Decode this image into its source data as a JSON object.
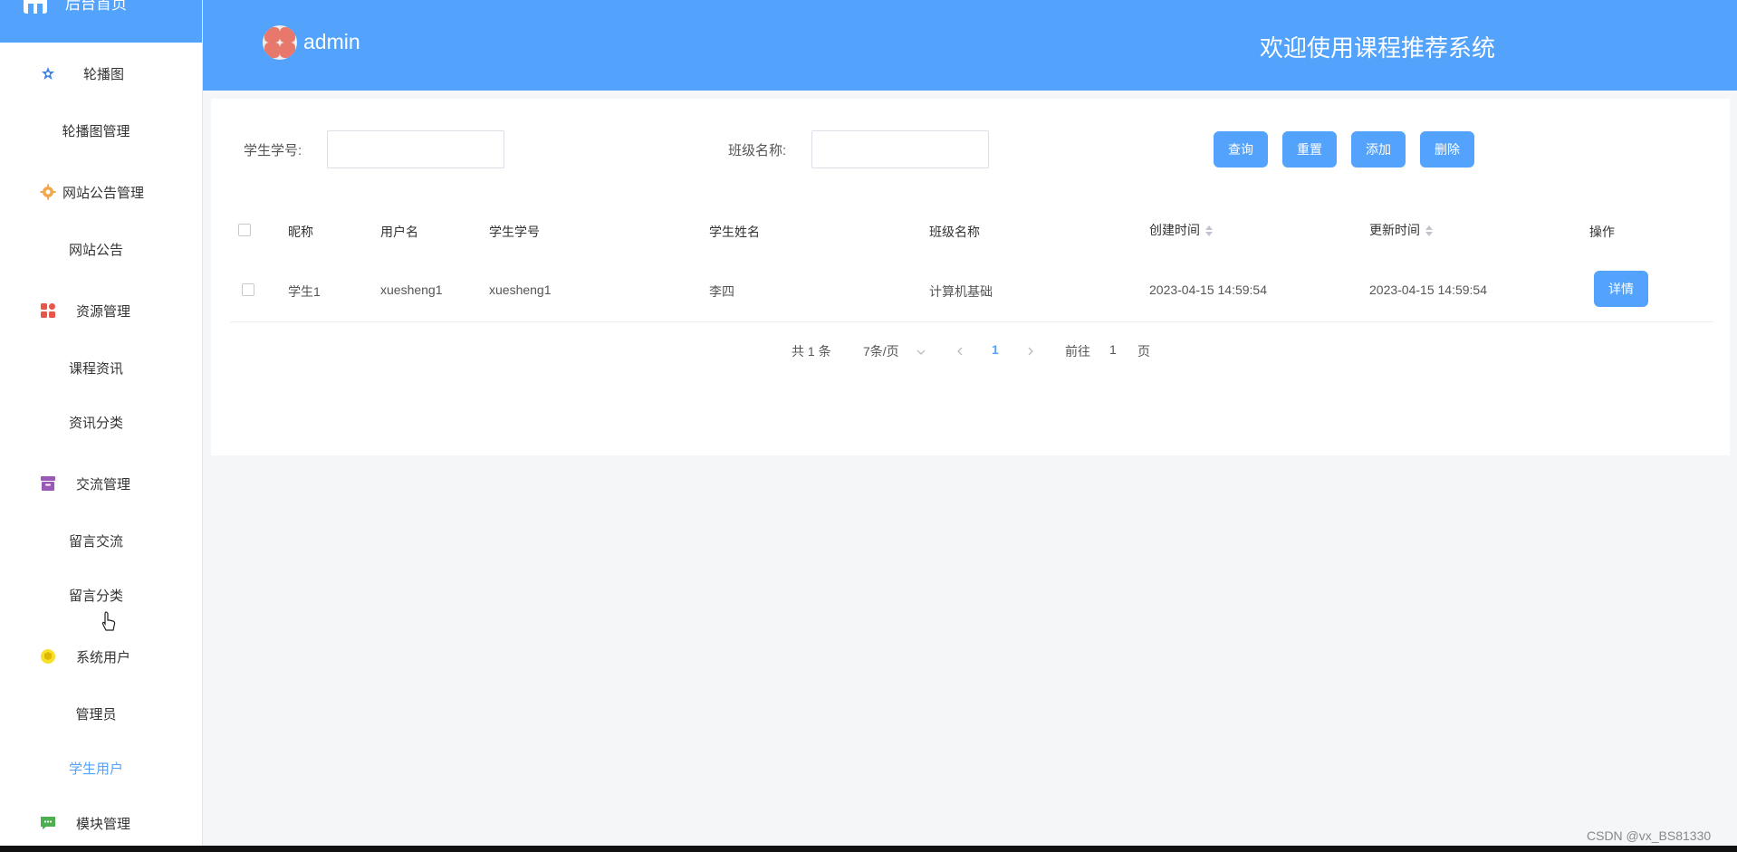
{
  "sidebar": {
    "top_label": "后台首页",
    "groups": [
      {
        "label": "轮播图",
        "icon": "star-icon",
        "items": [
          "轮播图管理"
        ]
      },
      {
        "label": "网站公告管理",
        "icon": "gear-icon",
        "items": [
          "网站公告"
        ]
      },
      {
        "label": "资源管理",
        "icon": "grid-icon",
        "items": [
          "课程资讯",
          "资讯分类"
        ]
      },
      {
        "label": "交流管理",
        "icon": "archive-icon",
        "items": [
          "留言交流",
          "留言分类"
        ]
      },
      {
        "label": "系统用户",
        "icon": "cube-icon",
        "items": [
          "管理员",
          "学生用户"
        ]
      },
      {
        "label": "模块管理",
        "icon": "chat-icon",
        "items": []
      }
    ],
    "active_item": "学生用户"
  },
  "header": {
    "username": "admin",
    "title": "欢迎使用课程推荐系统"
  },
  "search": {
    "student_no_label": "学生学号:",
    "student_no_value": "",
    "class_name_label": "班级名称:",
    "class_name_value": ""
  },
  "buttons": {
    "query": "查询",
    "reset": "重置",
    "add": "添加",
    "delete": "删除"
  },
  "table": {
    "headers": {
      "nickname": "昵称",
      "username": "用户名",
      "student_no": "学生学号",
      "student_name": "学生姓名",
      "class_name": "班级名称",
      "created": "创建时间",
      "updated": "更新时间",
      "actions": "操作"
    },
    "rows": [
      {
        "nickname": "学生1",
        "username": "xuesheng1",
        "student_no": "xuesheng1",
        "student_name": "李四",
        "class_name": "计算机基础",
        "created": "2023-04-15 14:59:54",
        "updated": "2023-04-15 14:59:54",
        "action": "详情"
      }
    ]
  },
  "pagination": {
    "total": "共 1 条",
    "page_size": "7条/页",
    "current_page": "1",
    "goto_label": "前往",
    "goto_value": "1",
    "page_suffix": "页"
  },
  "watermark": "CSDN @vx_BS81330",
  "colors": {
    "primary": "#53a3fc",
    "background": "#f5f6f8"
  }
}
